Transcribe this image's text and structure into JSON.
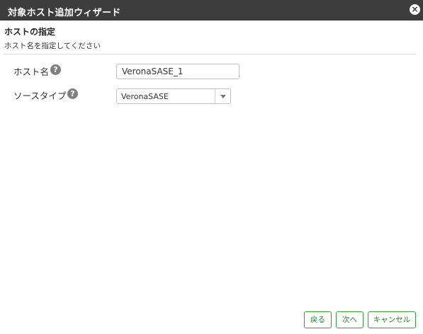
{
  "window": {
    "title": "対象ホスト追加ウィザード",
    "close_label": "×"
  },
  "section": {
    "title": "ホストの指定",
    "description": "ホスト名を指定してください"
  },
  "form": {
    "hostname": {
      "label": "ホスト名",
      "help": "?",
      "value": "VeronaSASE_1"
    },
    "source_type": {
      "label": "ソースタイプ",
      "help": "?",
      "selected": "VeronaSASE"
    }
  },
  "footer": {
    "back_label": "戻る",
    "next_label": "次へ",
    "cancel_label": "キャンセル"
  },
  "colors": {
    "titlebar": "#3d3d3d",
    "button_border": "#3a9a3a",
    "button_text": "#2d7d2d",
    "help_icon": "#808080"
  }
}
